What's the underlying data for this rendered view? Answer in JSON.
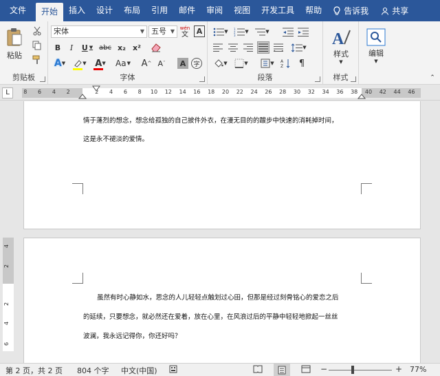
{
  "tabs": [
    "文件",
    "开始",
    "插入",
    "设计",
    "布局",
    "引用",
    "邮件",
    "审阅",
    "视图",
    "开发工具",
    "帮助"
  ],
  "active_tab": "开始",
  "tell_me": "告诉我",
  "share": "共享",
  "ribbon": {
    "clipboard": {
      "paste": "粘贴",
      "label": "剪贴板"
    },
    "font": {
      "name": "宋体",
      "size": "五号",
      "wen": "wén",
      "wen_char": "文",
      "A_border": "A",
      "bold": "B",
      "italic": "I",
      "underline": "U",
      "strike": "abc",
      "sub": "x₂",
      "sup": "x²",
      "grow": "A",
      "shrink": "A",
      "case": "Aa",
      "shading": "A",
      "label": "字体"
    },
    "paragraph": {
      "label": "段落"
    },
    "styles": {
      "button": "样式",
      "label": "样式"
    },
    "editing": {
      "button": "编辑"
    }
  },
  "ruler": {
    "corner": "L",
    "left_ticks": [
      "8",
      "6",
      "4",
      "2"
    ],
    "ticks": [
      "2",
      "4",
      "6",
      "8",
      "10",
      "12",
      "14",
      "16",
      "18",
      "20",
      "22",
      "24",
      "26",
      "28",
      "30",
      "32",
      "34",
      "36",
      "38"
    ],
    "right_ticks": [
      "40",
      "42",
      "44",
      "46"
    ]
  },
  "vruler": {
    "ticks": [
      "4",
      "2",
      "2",
      "4",
      "6"
    ]
  },
  "page1": {
    "line1": "情于蓬烈的想念，想念给孤独的自己披件外衣，在漫无目的的踱步中快速的消耗掉时间，",
    "line2": "这是永不褪淡的爱情。"
  },
  "page2": {
    "line1": "虽然有时心静如水，思念的人儿轻轻点触划过心田，但那是经过刻骨铭心的爱恋之后",
    "line2": "的延续，只要想念，就必然还在爱着，放在心里，在风浪过后的平静中轻轻地掀起一丝丝",
    "line3": "波澜，我永远记得你，你还好吗？"
  },
  "status": {
    "page": "第 2 页，共 2 页",
    "words": "804 个字",
    "lang": "中文(中国)",
    "zoom_minus": "−",
    "zoom_plus": "+",
    "zoom": "77%"
  },
  "colors": {
    "accent": "#2b579a",
    "font_color": "#e00000",
    "highlight": "#ffff00"
  }
}
